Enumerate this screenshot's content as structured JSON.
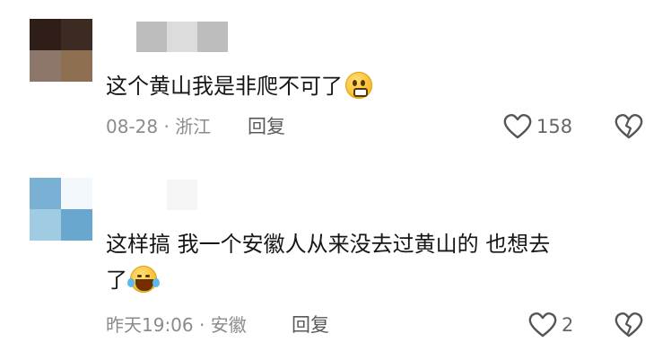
{
  "comments": [
    {
      "text": "这个黄山我是非爬不可了",
      "emoji": "pleading-face-emoji",
      "meta": "08-28 · 浙江",
      "reply_label": "回复",
      "likes": "158",
      "avatar_colors": [
        "#2e1e17",
        "#3b2b22",
        "#8c776a",
        "#8f6f52"
      ],
      "username_colors": [
        "#ffffff",
        "#bdbdbd",
        "#dcdcdc",
        "#bdbdbd"
      ]
    },
    {
      "text_line1": "这样搞 我一个安徽人从来没去过黄山的 也想去",
      "text_line2": "了",
      "emoji": "laughing-tears-emoji",
      "meta": "昨天19:06 · 安徽",
      "reply_label": "回复",
      "likes": "2",
      "avatar_colors": [
        "#79b0d3",
        "#f2f8fb",
        "#9fcbe3",
        "#6aa7cf"
      ],
      "username_colors": [
        "#ffffff",
        "#ffffff",
        "#f5f5f5",
        "#ffffff"
      ]
    }
  ],
  "icons": {
    "like": "heart-outline-icon",
    "dislike": "broken-heart-icon"
  }
}
